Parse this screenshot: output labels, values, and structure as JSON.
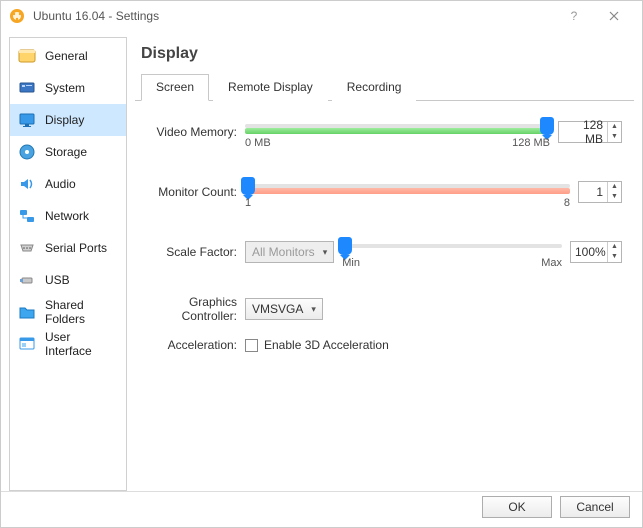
{
  "window": {
    "title": "Ubuntu 16.04 - Settings"
  },
  "sidebar": {
    "items": [
      {
        "label": "General"
      },
      {
        "label": "System"
      },
      {
        "label": "Display"
      },
      {
        "label": "Storage"
      },
      {
        "label": "Audio"
      },
      {
        "label": "Network"
      },
      {
        "label": "Serial Ports"
      },
      {
        "label": "USB"
      },
      {
        "label": "Shared Folders"
      },
      {
        "label": "User Interface"
      }
    ],
    "selected_index": 2
  },
  "page": {
    "title": "Display"
  },
  "tabs": {
    "items": [
      "Screen",
      "Remote Display",
      "Recording"
    ],
    "active_index": 0
  },
  "screen": {
    "video_memory": {
      "label": "Video Memory:",
      "value": "128 MB",
      "tick_min": "0 MB",
      "tick_max": "128 MB"
    },
    "monitor_count": {
      "label": "Monitor Count:",
      "value": "1",
      "tick_min": "1",
      "tick_max": "8"
    },
    "scale_factor": {
      "label": "Scale Factor:",
      "monitors": "All Monitors",
      "value": "100%",
      "tick_min": "Min",
      "tick_max": "Max"
    },
    "graphics_controller": {
      "label": "Graphics Controller:",
      "value": "VMSVGA"
    },
    "acceleration": {
      "label": "Acceleration:",
      "checkbox_label": "Enable 3D Acceleration",
      "checked": false
    }
  },
  "footer": {
    "ok": "OK",
    "cancel": "Cancel"
  }
}
